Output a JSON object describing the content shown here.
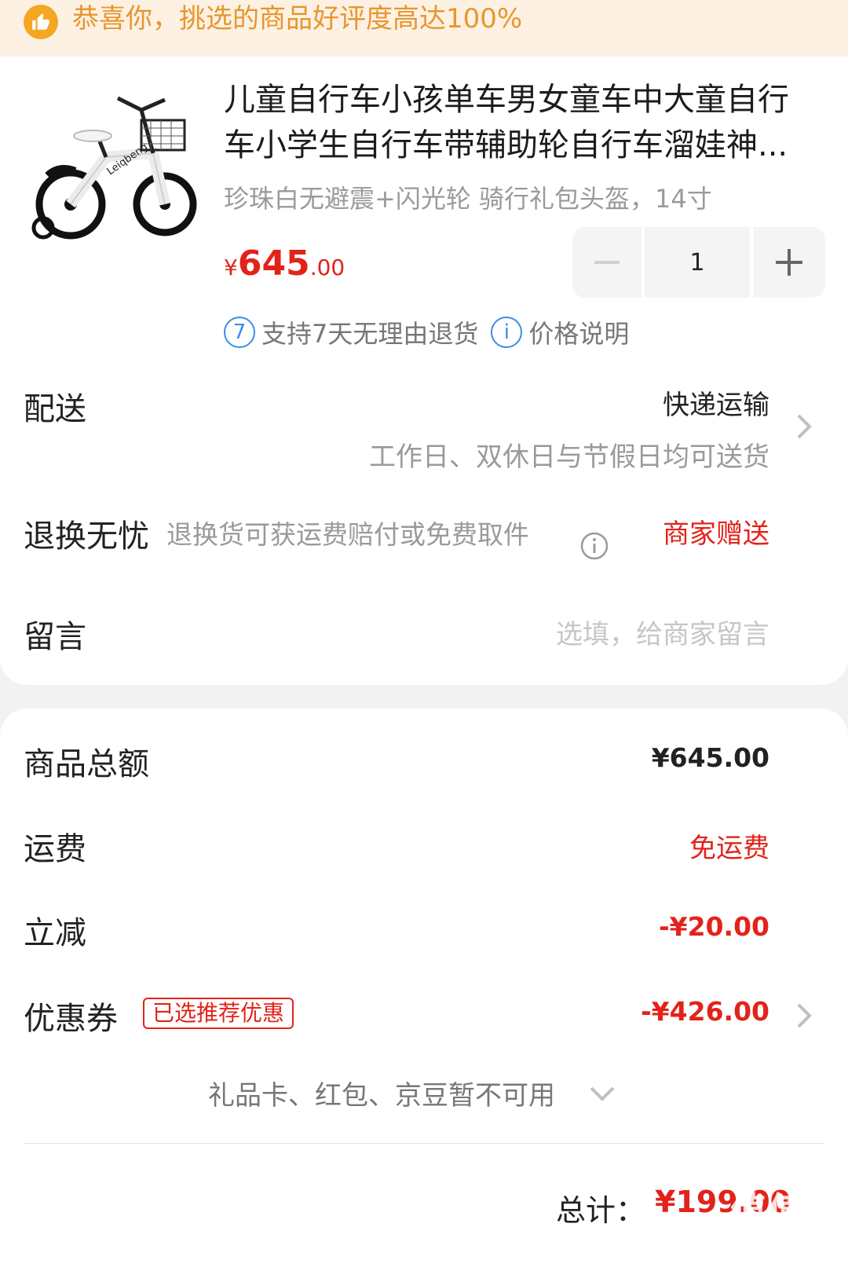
{
  "banner": {
    "text": "恭喜你，挑选的商品好评度高达100%",
    "icon": "thumbs-up-icon"
  },
  "product": {
    "title_line1": "儿童自行车小孩单车男女童车中大童自行",
    "title_line2": "车小学生自行车带辅助轮自行车溜娃神...",
    "spec": "珍珠白无避震+闪光轮 骑行礼包头盔，14寸",
    "price_symbol": "¥",
    "price_int": "645",
    "price_dec": ".00",
    "quantity": "1",
    "image_text": "Leiqbeng",
    "badge_return_icon": "7",
    "badge_return": "支持7天无理由退货",
    "badge_price_icon": "i",
    "badge_price": "价格说明"
  },
  "delivery": {
    "label": "配送",
    "method": "快递运输",
    "detail": "工作日、双休日与节假日均可送货"
  },
  "returns": {
    "label": "退换无忧",
    "detail": "退换货可获运费赔付或免费取件",
    "value": "商家赠送"
  },
  "message": {
    "label": "留言",
    "placeholder": "选填，给商家留言"
  },
  "summary": {
    "goods_label": "商品总额",
    "goods_value": "¥645.00",
    "shipping_label": "运费",
    "shipping_value": "免运费",
    "discount_label": "立减",
    "discount_value": "-¥20.00",
    "coupon_label": "优惠券",
    "coupon_tag": "已选推荐优惠",
    "coupon_value": "-¥426.00",
    "gift_text": "礼品卡、红包、京豆暂不可用",
    "total_label": "总计：",
    "total_value": "¥199.00"
  },
  "watermark": {
    "text": "值值值",
    "sub": "zhizhizhi.com"
  },
  "colors": {
    "accent_red": "#e2231a",
    "banner_bg": "#fdf1e4",
    "banner_text": "#e8962c",
    "info_blue": "#3a8ee6"
  }
}
